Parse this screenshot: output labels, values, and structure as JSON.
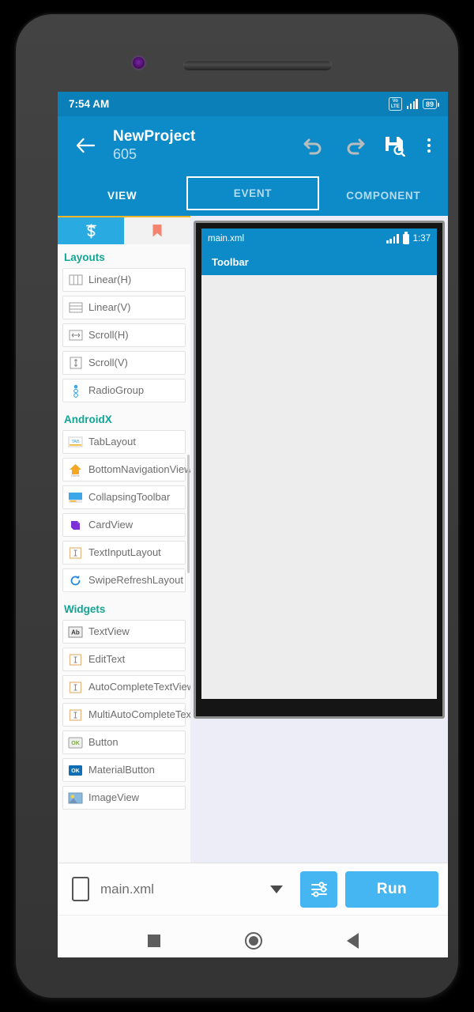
{
  "status_bar": {
    "time": "7:54 AM",
    "network": "VoLTE",
    "battery": "89"
  },
  "app_bar": {
    "back_icon": "arrow-left-icon",
    "title": "NewProject",
    "subtitle": "605",
    "undo_icon": "undo-icon",
    "redo_icon": "redo-icon",
    "save_icon": "save-icon",
    "overflow_icon": "more-vertical-icon"
  },
  "tabs": [
    {
      "label": "VIEW",
      "state": "active"
    },
    {
      "label": "EVENT",
      "state": "focused"
    },
    {
      "label": "COMPONENT",
      "state": "idle"
    }
  ],
  "palette": {
    "tabs": [
      {
        "name": "widgets-tab",
        "icon": "sketchware-s-icon",
        "active": true
      },
      {
        "name": "favorites-tab",
        "icon": "bookmark-icon",
        "active": false
      }
    ],
    "sections": [
      {
        "title": "Layouts",
        "items": [
          {
            "label": "Linear(H)",
            "icon": "linear-horizontal-icon"
          },
          {
            "label": "Linear(V)",
            "icon": "linear-vertical-icon"
          },
          {
            "label": "Scroll(H)",
            "icon": "scroll-horizontal-icon"
          },
          {
            "label": "Scroll(V)",
            "icon": "scroll-vertical-icon"
          },
          {
            "label": "RadioGroup",
            "icon": "radio-group-icon"
          }
        ]
      },
      {
        "title": "AndroidX",
        "items": [
          {
            "label": "TabLayout",
            "icon": "tab-layout-icon"
          },
          {
            "label": "BottomNavigationView",
            "icon": "bottom-navigation-icon"
          },
          {
            "label": "CollapsingToolbar",
            "icon": "collapsing-toolbar-icon"
          },
          {
            "label": "CardView",
            "icon": "card-view-icon"
          },
          {
            "label": "TextInputLayout",
            "icon": "text-input-layout-icon"
          },
          {
            "label": "SwipeRefreshLayout",
            "icon": "swipe-refresh-icon"
          }
        ]
      },
      {
        "title": "Widgets",
        "items": [
          {
            "label": "TextView",
            "icon": "text-view-icon"
          },
          {
            "label": "EditText",
            "icon": "edit-text-icon"
          },
          {
            "label": "AutoCompleteTextView",
            "icon": "autocomplete-text-icon"
          },
          {
            "label": "MultiAutoCompleteTextView",
            "icon": "multi-autocomplete-icon"
          },
          {
            "label": "Button",
            "icon": "button-icon"
          },
          {
            "label": "MaterialButton",
            "icon": "material-button-icon"
          },
          {
            "label": "ImageView",
            "icon": "image-view-icon"
          }
        ]
      }
    ]
  },
  "preview": {
    "file_name": "main.xml",
    "clock": "1:37",
    "toolbar_title": "Toolbar"
  },
  "bottom_bar": {
    "device_icon": "phone-icon",
    "selected_file": "main.xml",
    "dropdown_icon": "chevron-down-icon",
    "settings_icon": "sliders-icon",
    "run_label": "Run"
  },
  "nav_bar": {
    "recents_icon": "square-icon",
    "home_icon": "circle-icon",
    "back_icon": "triangle-back-icon"
  },
  "colors": {
    "primary": "#0D8BC9",
    "status_bar": "#0B7FB7",
    "accent_run": "#45B6F2",
    "section_header": "#12A594",
    "palette_tab_active": "#29AAE1",
    "bookmark": "#F4846F",
    "canvas_backdrop": "#EDEDF8"
  }
}
